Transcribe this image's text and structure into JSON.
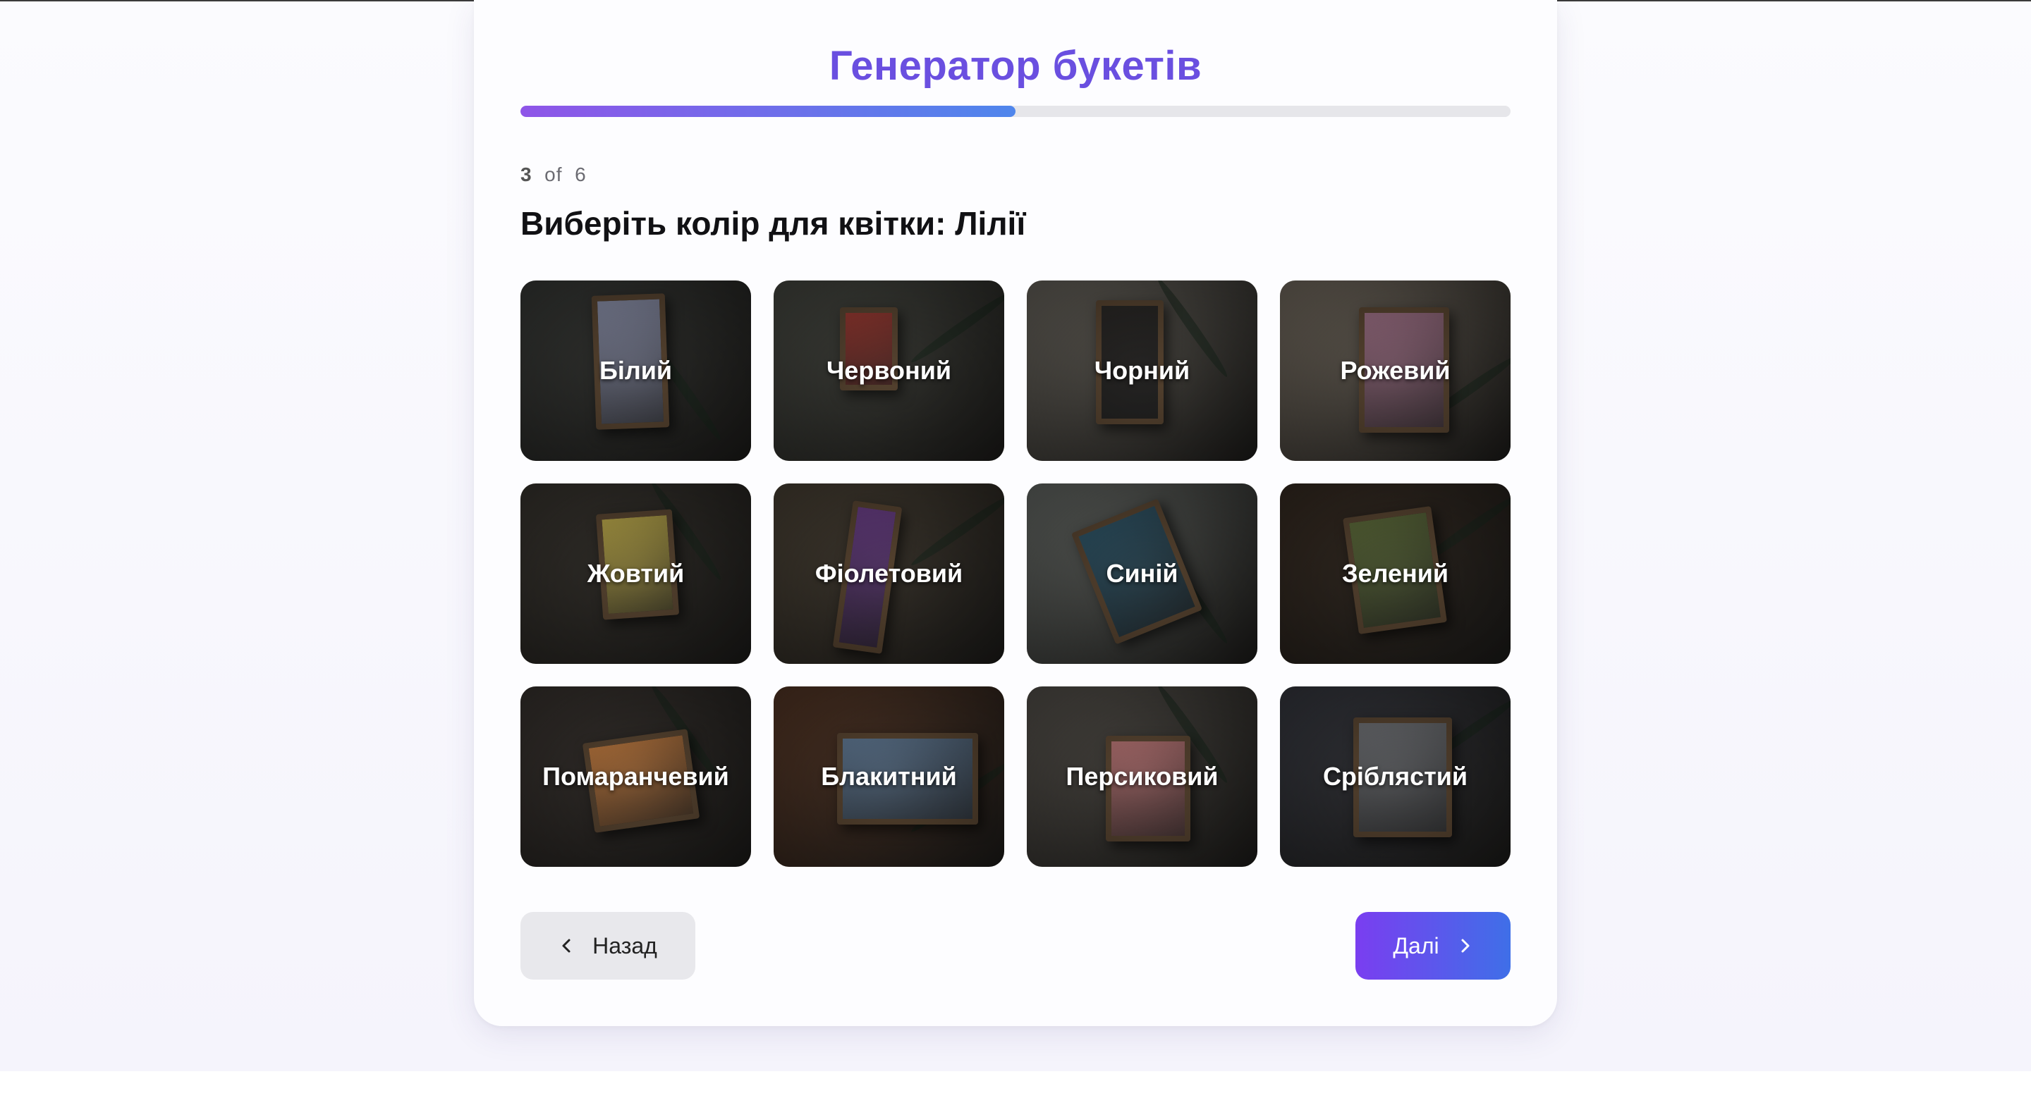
{
  "app": {
    "title": "Генератор букетів"
  },
  "progress": {
    "current": "3",
    "of_label": "of",
    "total": "6",
    "fraction": 0.5
  },
  "question": "Виберіть колір для квітки: Лілії",
  "options": [
    {
      "label": "Білий",
      "tone": "#8a8fa8",
      "wall": "#3b3d3a"
    },
    {
      "label": "Червоний",
      "tone": "#9a3a32",
      "wall": "#4a4c45"
    },
    {
      "label": "Чорний",
      "tone": "#2a2826",
      "wall": "#6e6a62"
    },
    {
      "label": "Рожевий",
      "tone": "#9c6f84",
      "wall": "#7b7266"
    },
    {
      "label": "Жовтий",
      "tone": "#b8a64a",
      "wall": "#3c3832"
    },
    {
      "label": "Фіолетовий",
      "tone": "#6a3f86",
      "wall": "#4e4538"
    },
    {
      "label": "Синій",
      "tone": "#2f5466",
      "wall": "#6c706c"
    },
    {
      "label": "Зелений",
      "tone": "#5c6a3a",
      "wall": "#3a2e24"
    },
    {
      "label": "Помаранчевий",
      "tone": "#b8763e",
      "wall": "#3c3632"
    },
    {
      "label": "Блакитний",
      "tone": "#5e7690",
      "wall": "#5a3a28"
    },
    {
      "label": "Персиковий",
      "tone": "#b07070",
      "wall": "#5a5650"
    },
    {
      "label": "Сріблястий",
      "tone": "#6e7074",
      "wall": "#3a3c44"
    }
  ],
  "nav": {
    "back_label": "Назад",
    "next_label": "Далі"
  },
  "colors": {
    "accent": "#6a4fe0",
    "progress_start": "#8f55e8",
    "progress_end": "#4f86ec",
    "next_start": "#7a3ef0",
    "next_end": "#3f6fe8"
  }
}
